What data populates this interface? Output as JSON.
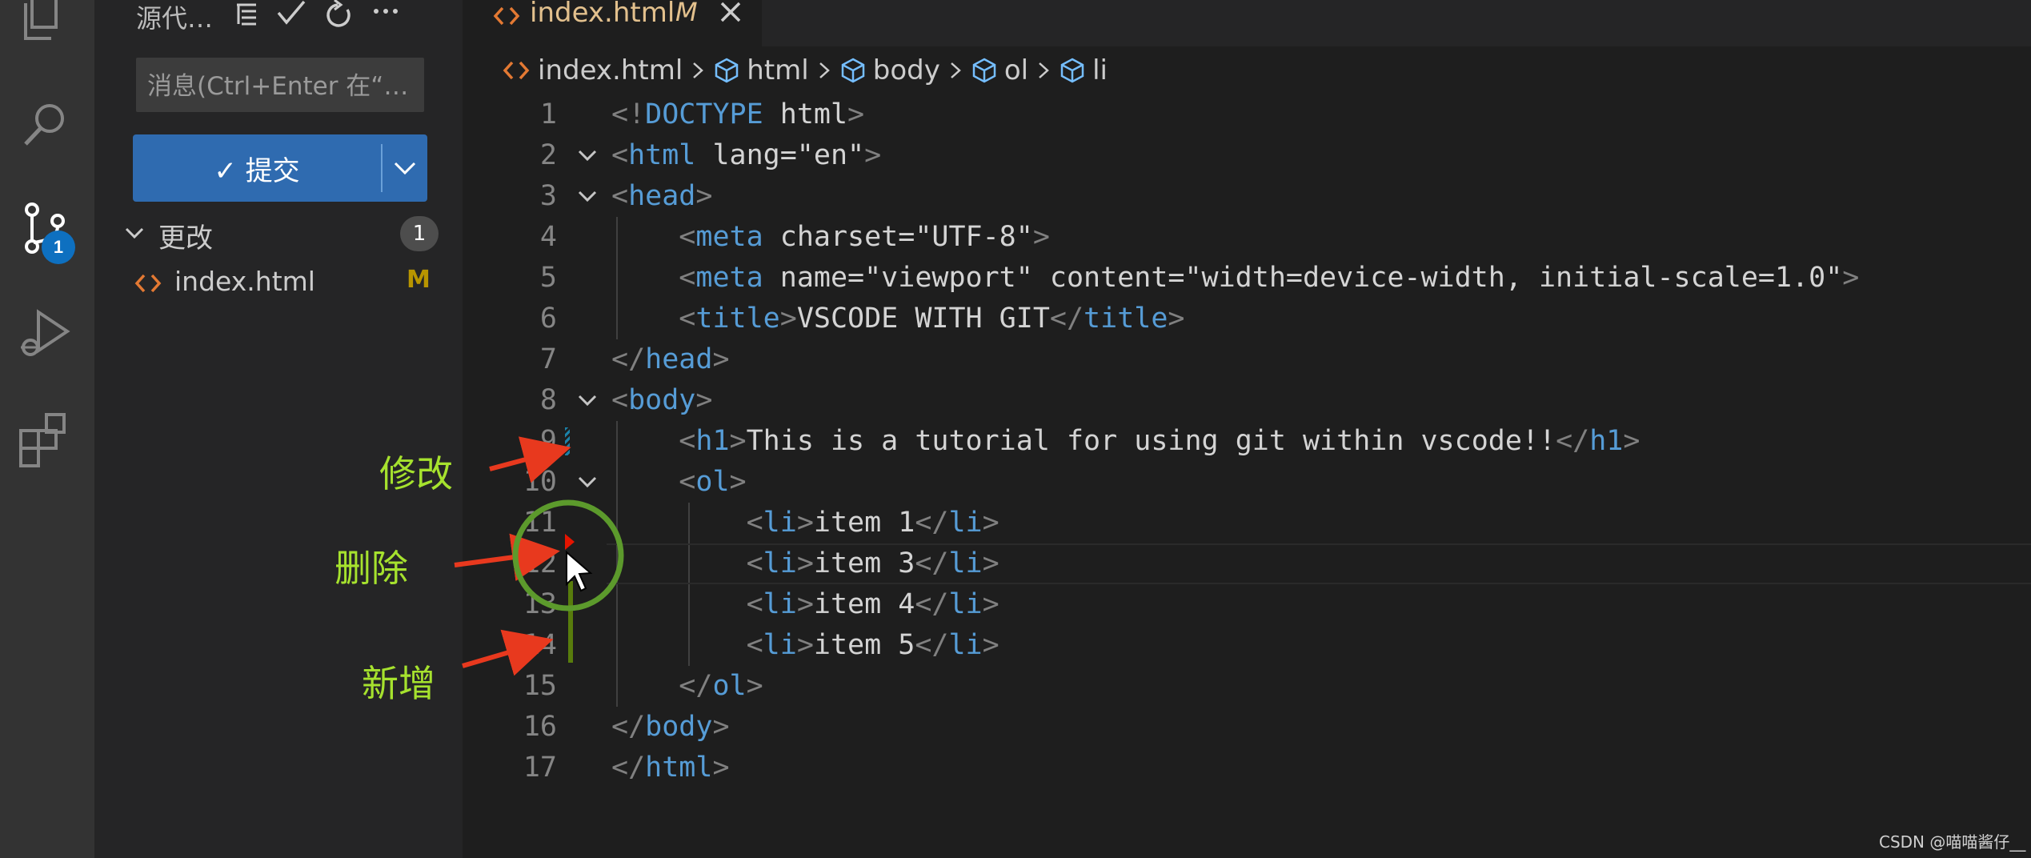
{
  "sidebar": {
    "title": "源代…",
    "commit_placeholder": "消息(Ctrl+Enter 在“…",
    "commit_button_label": "✓ 提交",
    "changes_label": "更改",
    "changes_count": "1",
    "files": [
      {
        "name": "index.html",
        "status": "M"
      }
    ]
  },
  "activity_bar": {
    "icons": [
      "explorer-icon",
      "search-icon",
      "source-control-icon",
      "run-debug-icon",
      "extensions-icon"
    ],
    "source_control_badge": "1"
  },
  "tab": {
    "name": "index.html",
    "status": "M"
  },
  "breadcrumb": [
    "index.html",
    "html",
    "body",
    "ol",
    "li"
  ],
  "editor": {
    "lines": [
      {
        "num": "1",
        "text": "<!DOCTYPE html>"
      },
      {
        "num": "2",
        "text": "<html lang=\"en\">"
      },
      {
        "num": "3",
        "text": "<head>"
      },
      {
        "num": "4",
        "text": "    <meta charset=\"UTF-8\">"
      },
      {
        "num": "5",
        "text": "    <meta name=\"viewport\" content=\"width=device-width, initial-scale=1.0\">"
      },
      {
        "num": "6",
        "text": "    <title>VSCODE WITH GIT</title>"
      },
      {
        "num": "7",
        "text": "</head>"
      },
      {
        "num": "8",
        "text": "<body>"
      },
      {
        "num": "9",
        "text": "    <h1>This is a tutorial for using git within vscode!!</h1>"
      },
      {
        "num": "10",
        "text": "    <ol>"
      },
      {
        "num": "11",
        "text": "        <li>item 1</li>"
      },
      {
        "num": "12",
        "text": "        <li>item 3</li>"
      },
      {
        "num": "13",
        "text": "        <li>item 4</li>"
      },
      {
        "num": "14",
        "text": "        <li>item 5</li>"
      },
      {
        "num": "15",
        "text": "    </ol>"
      },
      {
        "num": "16",
        "text": "</body>"
      },
      {
        "num": "17",
        "text": "</html>"
      }
    ]
  },
  "annotations": {
    "modified": "修改",
    "deleted": "删除",
    "added": "新增"
  },
  "watermark": "CSDN @喵喵酱仔__",
  "colors": {
    "accent_blue": "#2f6bb0",
    "modified_stripe": "#1b81a8",
    "deleted_marker": "#e51400",
    "added_stripe": "#587c0c",
    "annotation_text": "#a6e22e",
    "annotation_arrow": "#e8391e",
    "circle": "#5c9a2c"
  }
}
